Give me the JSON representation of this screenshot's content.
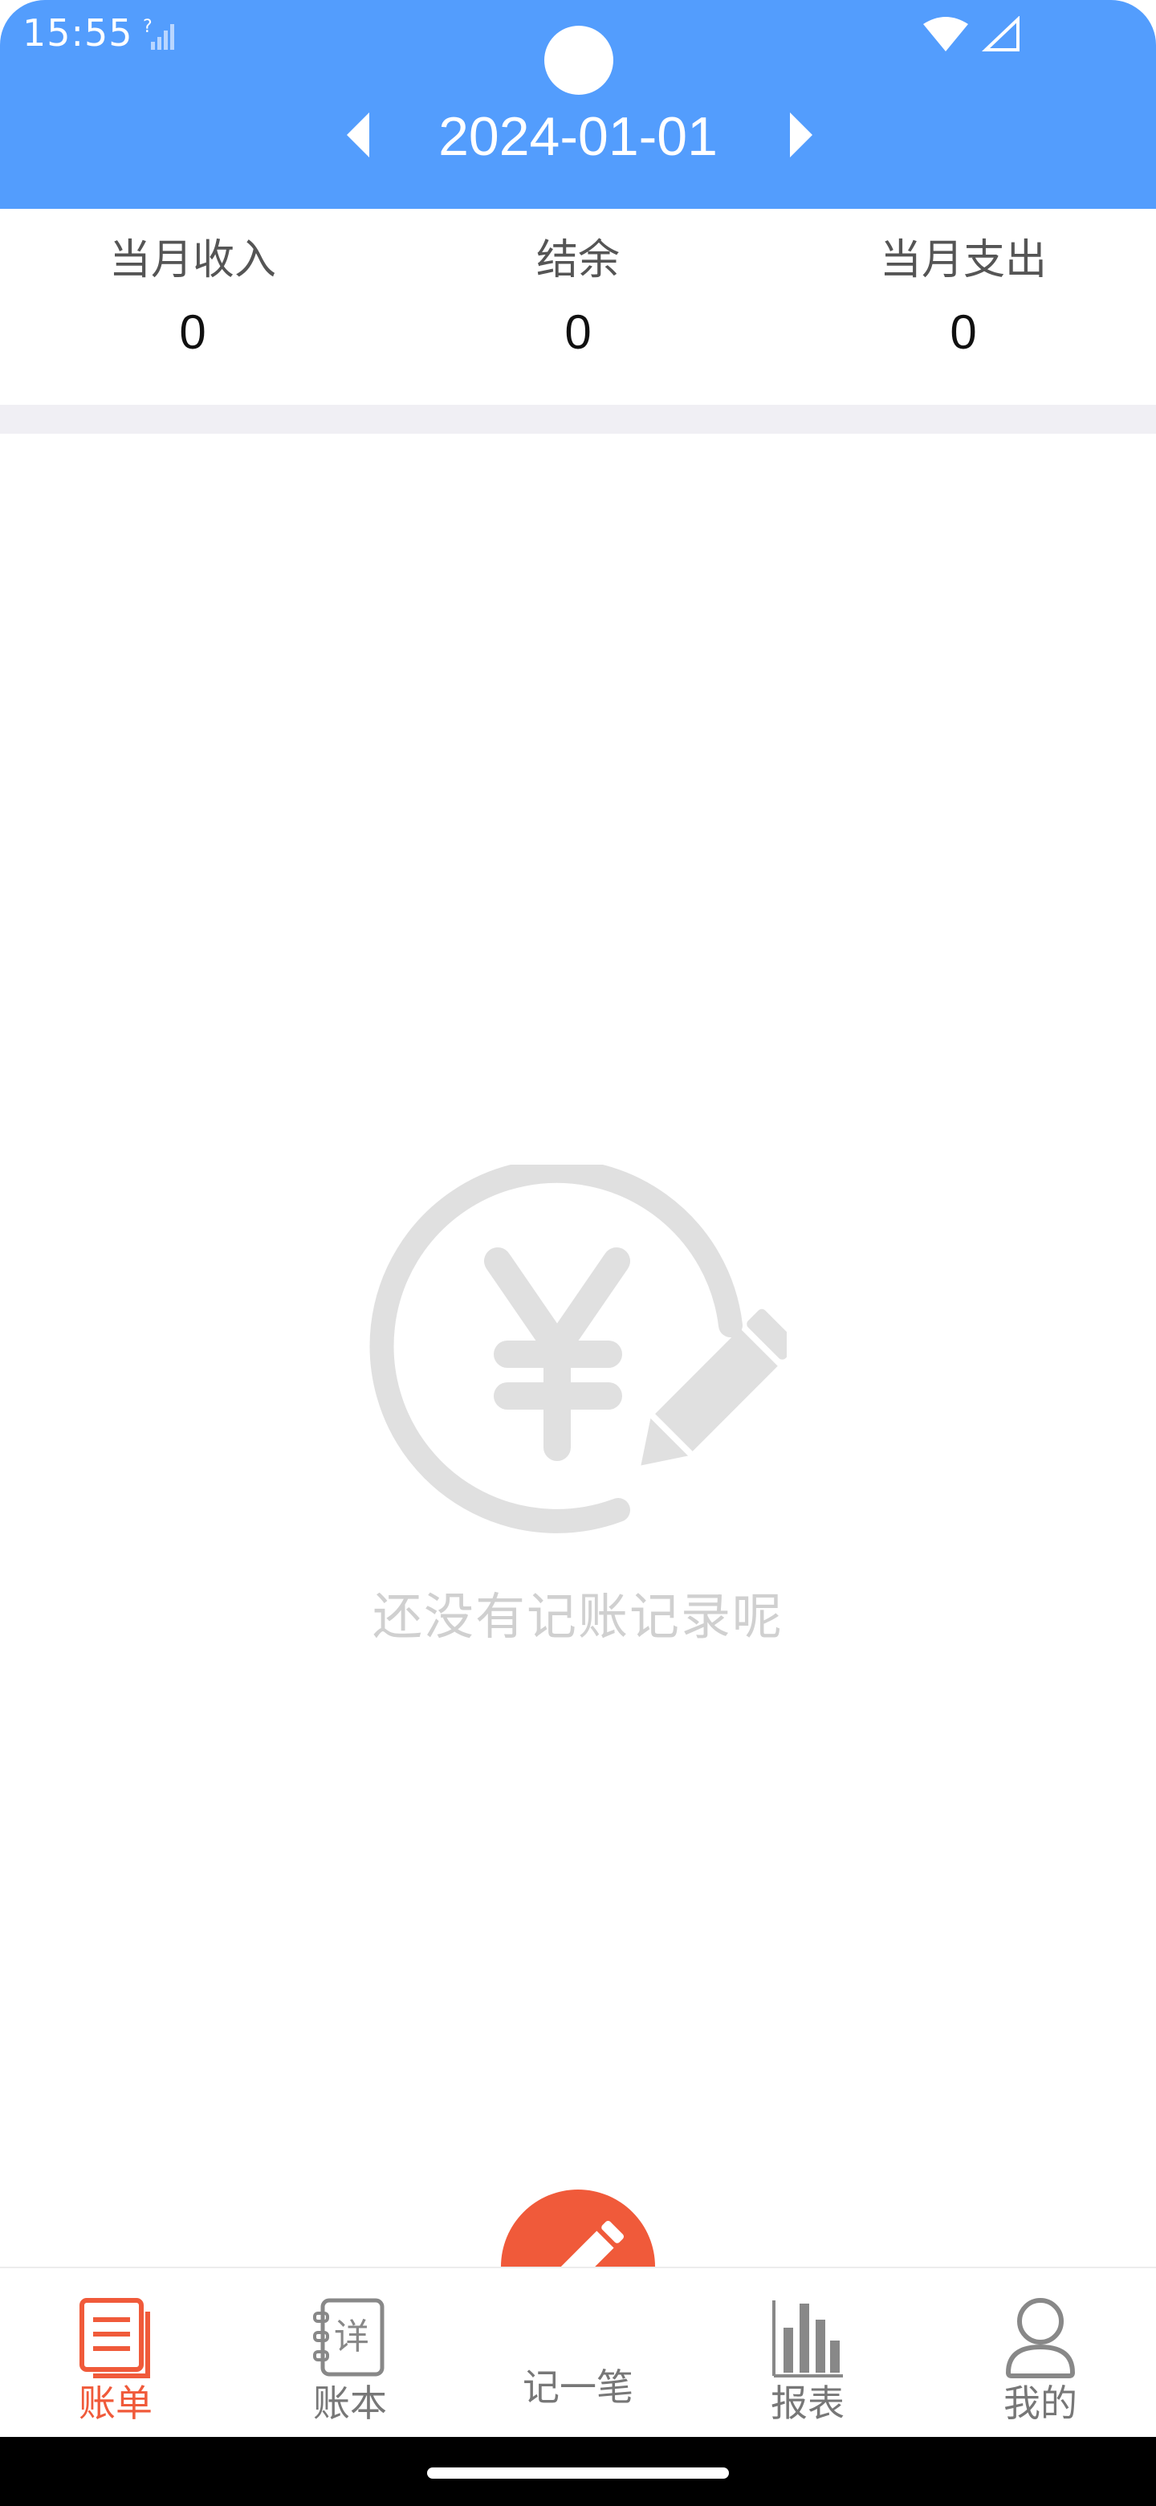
{
  "status_bar": {
    "time": "15:55",
    "signal_left_icon": "signal-unknown-icon",
    "wifi_icon": "wifi-icon",
    "cell_icon": "cell-signal-icon"
  },
  "header": {
    "date": "2024-01-01",
    "prev_icon": "caret-left-icon",
    "next_icon": "caret-right-icon",
    "background_color": "#539dfd"
  },
  "summary": {
    "income_label": "当月收入",
    "income_value": "0",
    "balance_label": "结余",
    "balance_value": "0",
    "expense_label": "当月支出",
    "expense_value": "0"
  },
  "empty_state": {
    "icon": "yen-pencil-icon",
    "message": "还没有记账记录呢"
  },
  "bottom_nav": {
    "accent_color": "#f05a3a",
    "items": [
      {
        "label": "账单",
        "icon": "bill-icon",
        "active": true
      },
      {
        "label": "账本",
        "icon": "ledger-icon",
        "active": false
      },
      {
        "label": "记一笔",
        "icon": "pencil-icon",
        "active": false
      },
      {
        "label": "报表",
        "icon": "bar-chart-icon",
        "active": false
      },
      {
        "label": "我的",
        "icon": "user-icon",
        "active": false
      }
    ]
  }
}
